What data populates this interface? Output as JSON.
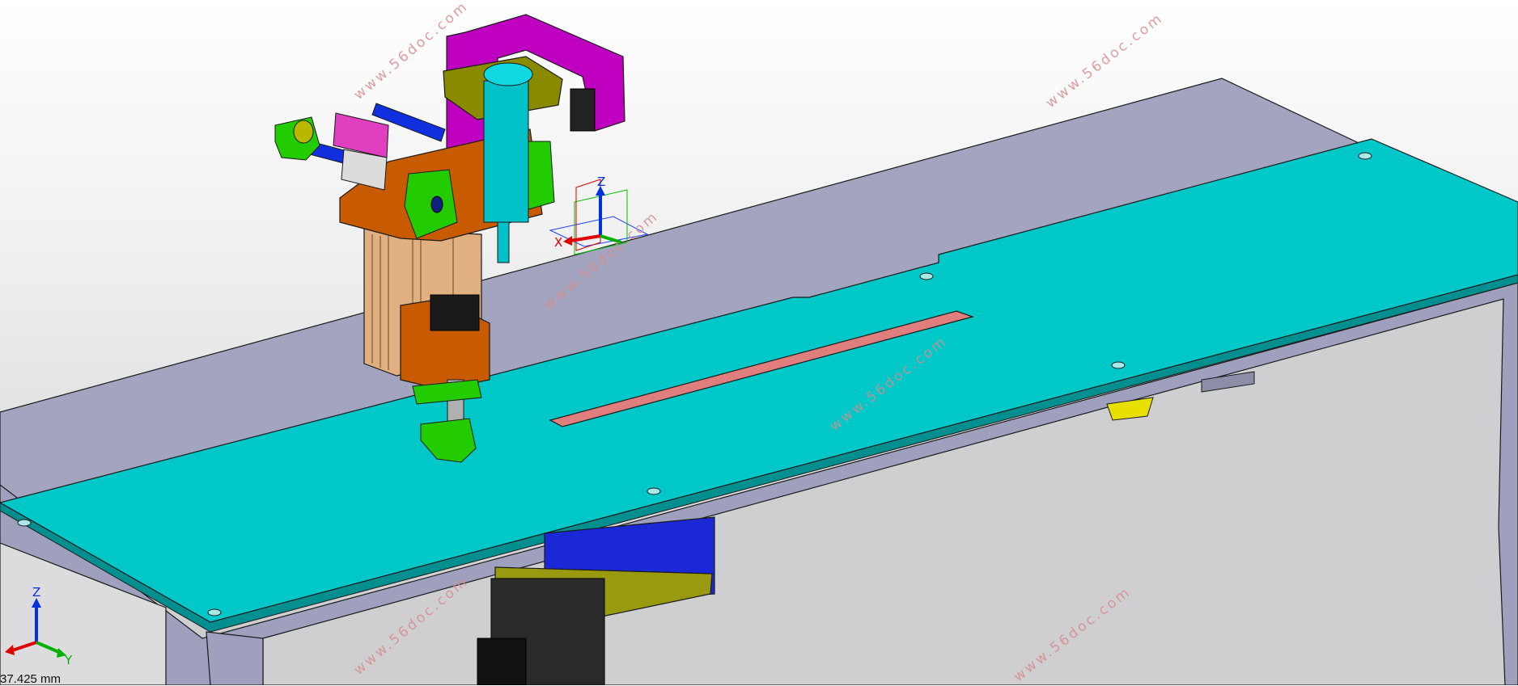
{
  "viewport": {
    "scale_readout": "37.425 mm",
    "triad_labels": {
      "x": "X",
      "y": "Y",
      "z": "Z"
    },
    "widget_labels": {
      "x": "X",
      "z": "Z"
    },
    "watermarks": [
      "www.56doc.com",
      "www.56doc.com",
      "www.56doc.com",
      "www.56doc.com",
      "www.56doc.com",
      "www.56doc.com"
    ]
  },
  "colors": {
    "table_top": "#00c8c8",
    "table_edge": "#008f8f",
    "frame": "#a2a4c0",
    "slot": "#e07e7e",
    "bracket_magenta": "#c000c0",
    "cylinder_cyan": "#00c0c8",
    "block_orange": "#c85a00",
    "block_tan": "#e0b080",
    "olive": "#8a8a00",
    "green_parts": "#22cc00",
    "blue_rods": "#1030e0",
    "axis_x": "#e00000",
    "axis_y": "#00b000",
    "axis_z": "#0030e0"
  },
  "icons": {
    "view_triad": "axis-triad-icon",
    "move_gizmo": "move-gizmo-icon"
  }
}
